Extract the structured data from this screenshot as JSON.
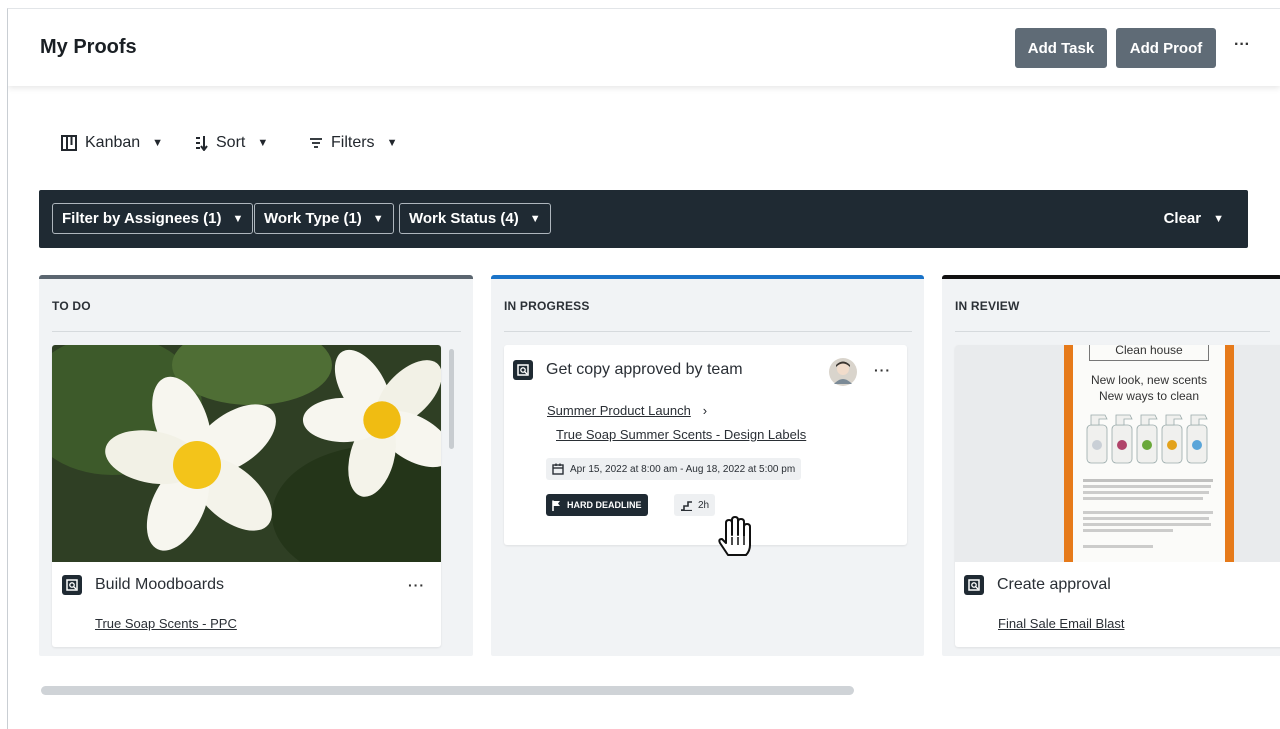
{
  "header": {
    "title": "My Proofs",
    "add_task_label": "Add Task",
    "add_proof_label": "Add Proof",
    "more_label": "···"
  },
  "toolbar": {
    "view_label": "Kanban",
    "sort_label": "Sort",
    "filters_label": "Filters"
  },
  "filterbar": {
    "assignees_label": "Filter by Assignees (1)",
    "work_type_label": "Work Type (1)",
    "work_status_label": "Work Status (4)",
    "clear_label": "Clear"
  },
  "columns": [
    {
      "title": "TO DO",
      "accent": "#5b6670",
      "card": {
        "title": "Build Moodboards",
        "link": "True Soap Scents - PPC",
        "more": "···"
      }
    },
    {
      "title": "IN PROGRESS",
      "accent": "#1a73c8",
      "card": {
        "title": "Get copy approved by team",
        "parent_link": "Summer Product Launch",
        "separator": "›",
        "link": "True Soap Summer Scents - Design Labels",
        "date_range": "Apr 15, 2022 at 8:00 am - Aug 18, 2022 at 5:00 pm",
        "deadline_badge": "HARD DEADLINE",
        "effort": "2h",
        "more": "···"
      }
    },
    {
      "title": "IN REVIEW",
      "accent": "#111111",
      "card": {
        "title": "Create approval",
        "link": "Final Sale Email Blast",
        "preview_heading": "Clean house",
        "preview_line1": "New look, new scents",
        "preview_line2": "New ways to clean"
      }
    }
  ],
  "colors": {
    "dark_button": "#5f6b76",
    "filterbar_bg": "#1f2a33",
    "progress_accent": "#1a73c8"
  }
}
